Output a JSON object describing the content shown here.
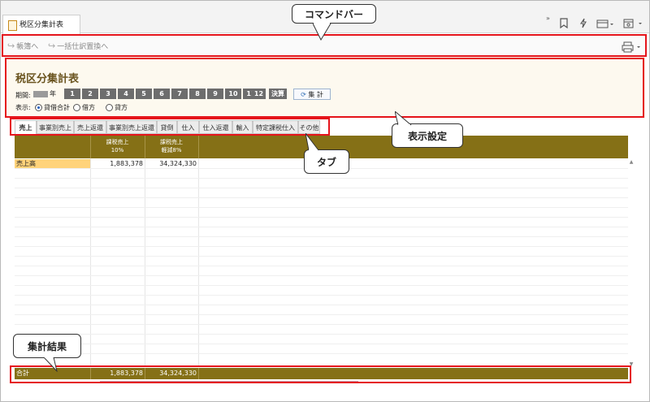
{
  "window": {
    "tab_title": "税区分集計表"
  },
  "toolbar_right": {
    "chevron": "»"
  },
  "commands": {
    "ledger_label": "帳簿へ",
    "bulk_replace_label": "一括仕訳置換へ"
  },
  "settings": {
    "title": "税区分集計表",
    "period_label": "期間:",
    "year_suffix": "年",
    "months": [
      "1",
      "2",
      "3",
      "4",
      "5",
      "6",
      "7",
      "8",
      "9",
      "10",
      "11",
      "12",
      "決算"
    ],
    "calc_label": "集 計",
    "display_label": "表示:",
    "radio_options": [
      "貸借合計",
      "借方",
      "貸方"
    ],
    "radio_selected": "貸借合計"
  },
  "tabs": [
    "売上",
    "事業別売上",
    "売上返還",
    "事業別売上返還",
    "貸倒",
    "仕入",
    "仕入返還",
    "輸入",
    "特定課税仕入",
    "その他"
  ],
  "active_tab": "売上",
  "table": {
    "columns": [
      {
        "line1": "課税売上",
        "line2": "10%"
      },
      {
        "line1": "課税売上",
        "line2": "軽減8%"
      }
    ],
    "rows": [
      {
        "label": "売上高",
        "values": [
          "1,883,378",
          "34,324,330"
        ]
      }
    ],
    "total": {
      "label": "合計",
      "values": [
        "1,883,378",
        "34,324,330"
      ]
    }
  },
  "annotations": {
    "command_bar": "コマンドバー",
    "display_settings": "表示設定",
    "tabs": "タブ",
    "totals": "集計結果"
  },
  "colors": {
    "header_band": "#857016",
    "highlight": "#e5141b",
    "row_label": "#ffd37a",
    "settings_bg": "#fdf9ef"
  }
}
